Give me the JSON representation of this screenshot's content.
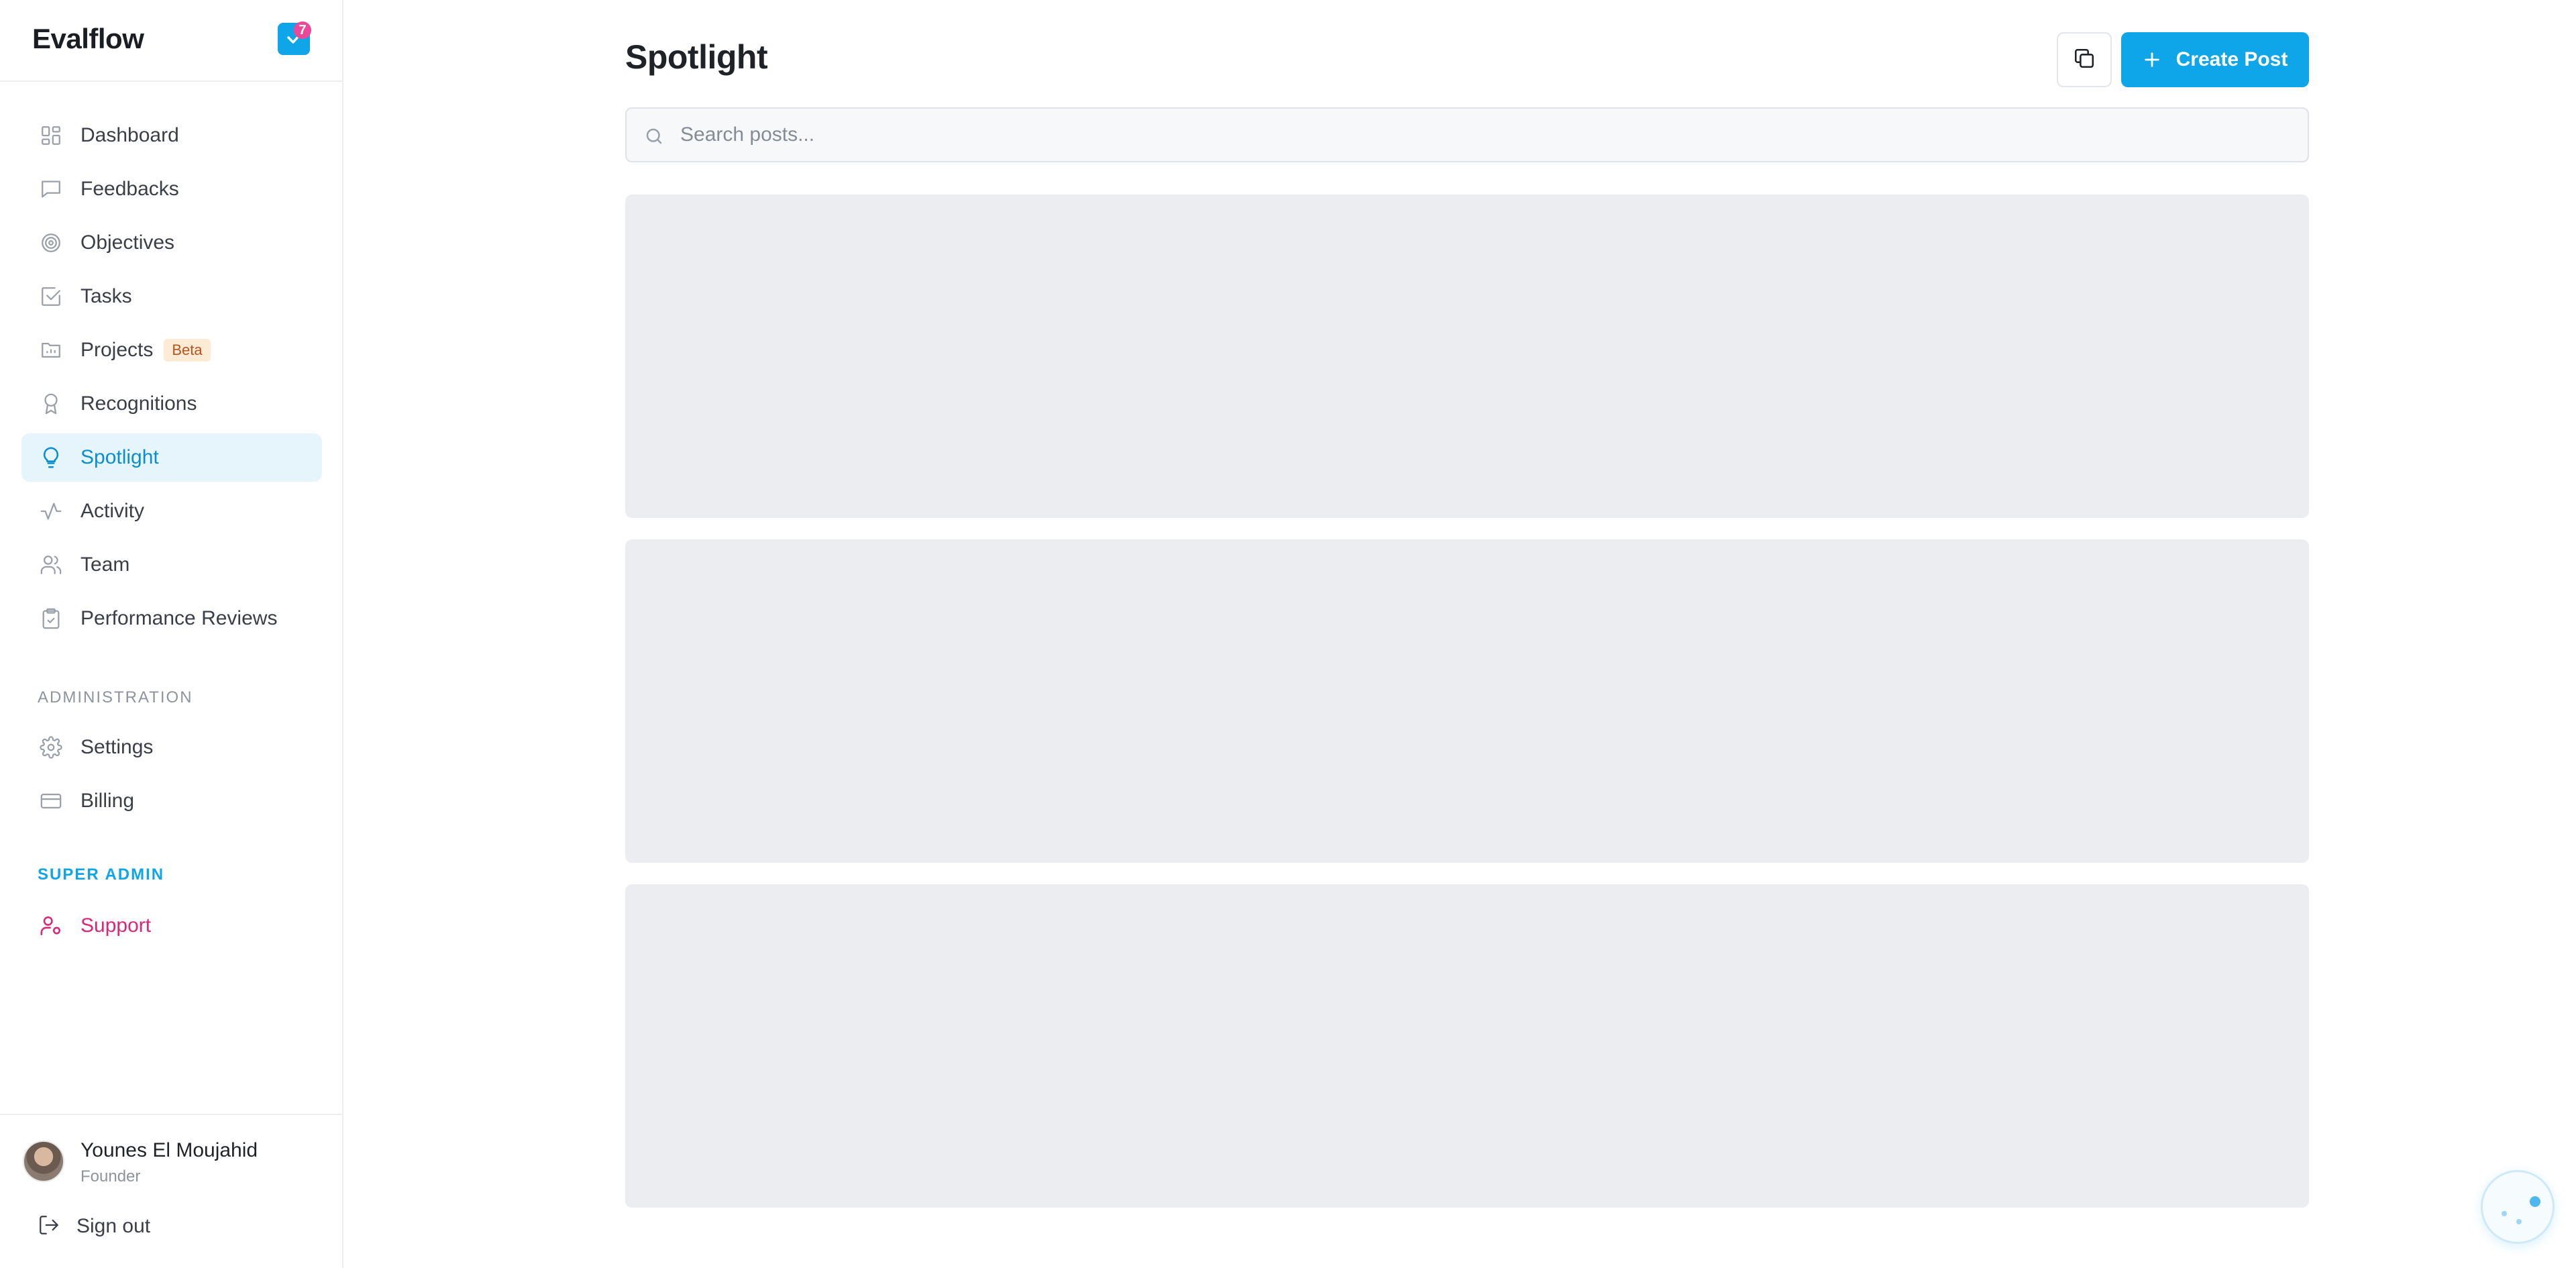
{
  "brand": {
    "name": "Evalflow",
    "notification_count": "7"
  },
  "nav": {
    "items": [
      {
        "label": "Dashboard",
        "icon": "dashboard-icon"
      },
      {
        "label": "Feedbacks",
        "icon": "message-square-icon"
      },
      {
        "label": "Objectives",
        "icon": "target-icon"
      },
      {
        "label": "Tasks",
        "icon": "check-square-icon"
      },
      {
        "label": "Projects",
        "icon": "folder-chart-icon",
        "badge": "Beta"
      },
      {
        "label": "Recognitions",
        "icon": "award-icon"
      },
      {
        "label": "Spotlight",
        "icon": "lightbulb-icon",
        "active": true
      },
      {
        "label": "Activity",
        "icon": "activity-icon"
      },
      {
        "label": "Team",
        "icon": "users-icon"
      },
      {
        "label": "Performance Reviews",
        "icon": "clipboard-check-icon"
      }
    ],
    "admin_section_label": "ADMINISTRATION",
    "admin_items": [
      {
        "label": "Settings",
        "icon": "gear-icon"
      },
      {
        "label": "Billing",
        "icon": "credit-card-icon"
      }
    ],
    "super_admin_section_label": "SUPER ADMIN",
    "super_admin_items": [
      {
        "label": "Support",
        "icon": "user-cog-icon"
      }
    ]
  },
  "user": {
    "name": "Younes El Moujahid",
    "role": "Founder"
  },
  "signout_label": "Sign out",
  "main": {
    "title": "Spotlight",
    "create_button_label": "Create Post",
    "search": {
      "placeholder": "Search posts...",
      "value": ""
    },
    "loading_cards": 3
  },
  "colors": {
    "accent": "#0ea5e9",
    "active_bg": "#e6f4fb",
    "super_admin": "#0ea5e9",
    "support": "#db2777",
    "beta_bg": "#fdebd6",
    "beta_text": "#b8541e",
    "skeleton": "#ebedf0"
  }
}
